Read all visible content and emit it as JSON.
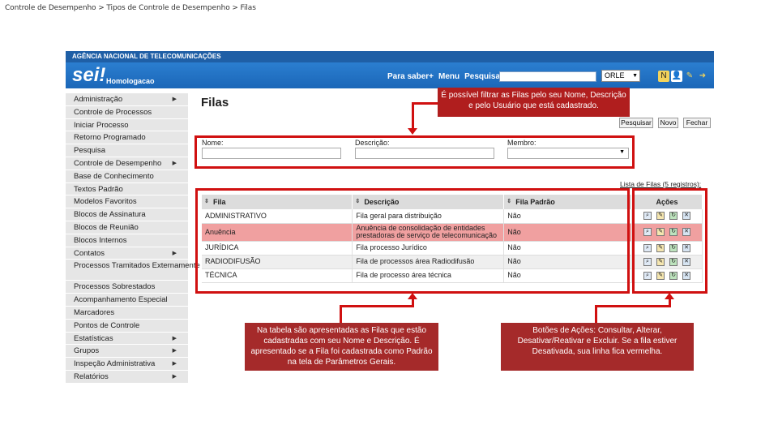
{
  "slide": {
    "breadcrumb": "Controle de Desempenho > Tipos de Controle de Desempenho > Filas"
  },
  "app": {
    "org_name": "AGÊNCIA NACIONAL DE TELECOMUNICAÇÕES",
    "logo": "sei!",
    "environment": "Homologacao",
    "header_links": [
      "Para saber+",
      "Menu",
      "Pesquisa"
    ],
    "unit_selected": "ORLE",
    "header_icons": [
      "notification-icon",
      "user-icon",
      "tools-icon",
      "exit-icon"
    ]
  },
  "sidebar": {
    "items": [
      {
        "label": "Administração",
        "submenu": true
      },
      {
        "label": "Controle de Processos",
        "submenu": false
      },
      {
        "label": "Iniciar Processo",
        "submenu": false
      },
      {
        "label": "Retorno Programado",
        "submenu": false
      },
      {
        "label": "Pesquisa",
        "submenu": false
      },
      {
        "label": "Controle de Desempenho",
        "submenu": true
      },
      {
        "label": "Base de Conhecimento",
        "submenu": false
      },
      {
        "label": "Textos Padrão",
        "submenu": false
      },
      {
        "label": "Modelos Favoritos",
        "submenu": false
      },
      {
        "label": "Blocos de Assinatura",
        "submenu": false
      },
      {
        "label": "Blocos de Reunião",
        "submenu": false
      },
      {
        "label": "Blocos Internos",
        "submenu": false
      },
      {
        "label": "Contatos",
        "submenu": true
      },
      {
        "label": "Processos Tramitados Externamente",
        "submenu": false,
        "tall": true
      },
      {
        "label": "Processos Sobrestados",
        "submenu": false
      },
      {
        "label": "Acompanhamento Especial",
        "submenu": false
      },
      {
        "label": "Marcadores",
        "submenu": false
      },
      {
        "label": "Pontos de Controle",
        "submenu": false
      },
      {
        "label": "Estatísticas",
        "submenu": true
      },
      {
        "label": "Grupos",
        "submenu": true
      },
      {
        "label": "Inspeção Administrativa",
        "submenu": true
      },
      {
        "label": "Relatórios",
        "submenu": true
      }
    ]
  },
  "main": {
    "title": "Filas",
    "buttons": {
      "search": "Pesquisar",
      "new": "Novo",
      "close": "Fechar"
    },
    "filters": {
      "name_label": "Nome:",
      "name_value": "",
      "description_label": "Descrição:",
      "description_value": "",
      "member_label": "Membro:",
      "member_value": ""
    },
    "list_caption": "Lista de Filas (5 registros):",
    "table": {
      "headers": [
        "Fila",
        "Descrição",
        "Fila Padrão",
        "Ações"
      ],
      "rows": [
        {
          "fila": "ADMINISTRATIVO",
          "descricao": "Fila geral para distribuição",
          "padrao": "Não",
          "inactive": false
        },
        {
          "fila": "Anuência",
          "descricao": "Anuência de consolidação de entidades prestadoras de serviço de telecomunicação",
          "padrao": "Não",
          "inactive": true
        },
        {
          "fila": "JURÍDICA",
          "descricao": "Fila processo Jurídico",
          "padrao": "Não",
          "inactive": false
        },
        {
          "fila": "RADIODIFUSÃO",
          "descricao": "Fila de processos área Radiodifusão",
          "padrao": "Não",
          "inactive": false
        },
        {
          "fila": "TÉCNICA",
          "descricao": "Fila de processo área técnica",
          "padrao": "Não",
          "inactive": false
        }
      ],
      "action_icons": [
        "consult-icon",
        "edit-icon",
        "toggle-active-icon",
        "delete-icon"
      ]
    }
  },
  "annotations": {
    "filter_note": "É possível filtrar as Filas pelo seu Nome, Descrição e pelo Usuário que está cadastrado.",
    "table_note": "Na tabela são apresentadas as Filas que estão cadastradas com seu Nome e Descrição. É apresentado se a Fila foi cadastrada como Padrão na tela de Parâmetros Gerais.",
    "actions_note": "Botões de Ações: Consultar, Alterar, Desativar/Reativar e Excluir. Se a fila estiver Desativada, sua linha fica vermelha.",
    "colors": {
      "filter_note_bg": "#b01e1e",
      "table_note_bg": "#a52a2a",
      "actions_note_bg": "#a52a2a",
      "highlight": "#d01010",
      "inactive_row": "#f0a0a0"
    }
  }
}
